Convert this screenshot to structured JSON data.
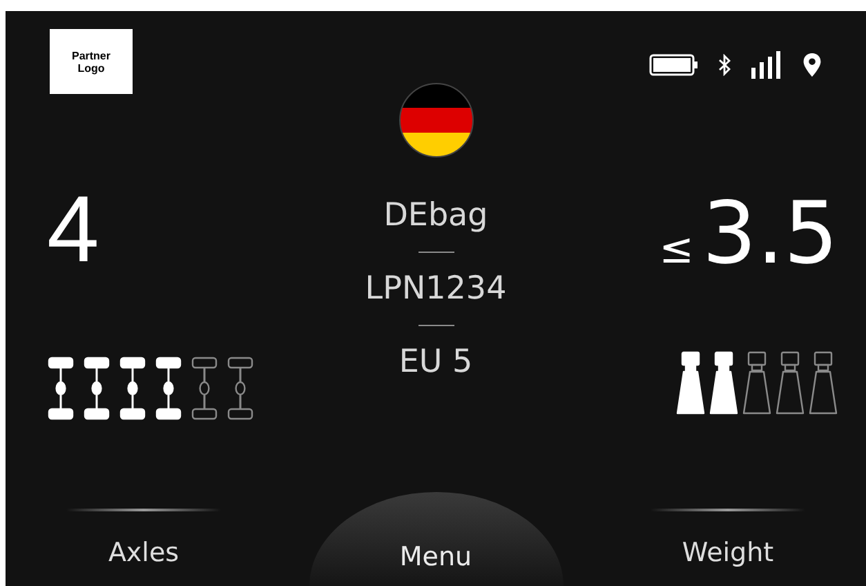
{
  "logo": {
    "text": "Partner Logo"
  },
  "country": {
    "flag_stripes": [
      {
        "color": "#000000"
      },
      {
        "color": "#dd0000"
      },
      {
        "color": "#ffce00"
      }
    ]
  },
  "axles": {
    "value": "4",
    "label": "Axles",
    "icons": [
      {
        "on": true
      },
      {
        "on": true
      },
      {
        "on": true
      },
      {
        "on": true
      },
      {
        "on": false
      },
      {
        "on": false
      }
    ]
  },
  "vehicle": {
    "name": "DEbag",
    "plate": "LPN1234",
    "emission": "EU 5"
  },
  "weight": {
    "prefix": "≤",
    "value": "3.5",
    "label": "Weight",
    "icons": [
      {
        "on": true
      },
      {
        "on": true
      },
      {
        "on": false
      },
      {
        "on": false
      },
      {
        "on": false
      }
    ]
  },
  "menu": {
    "label": "Menu"
  }
}
